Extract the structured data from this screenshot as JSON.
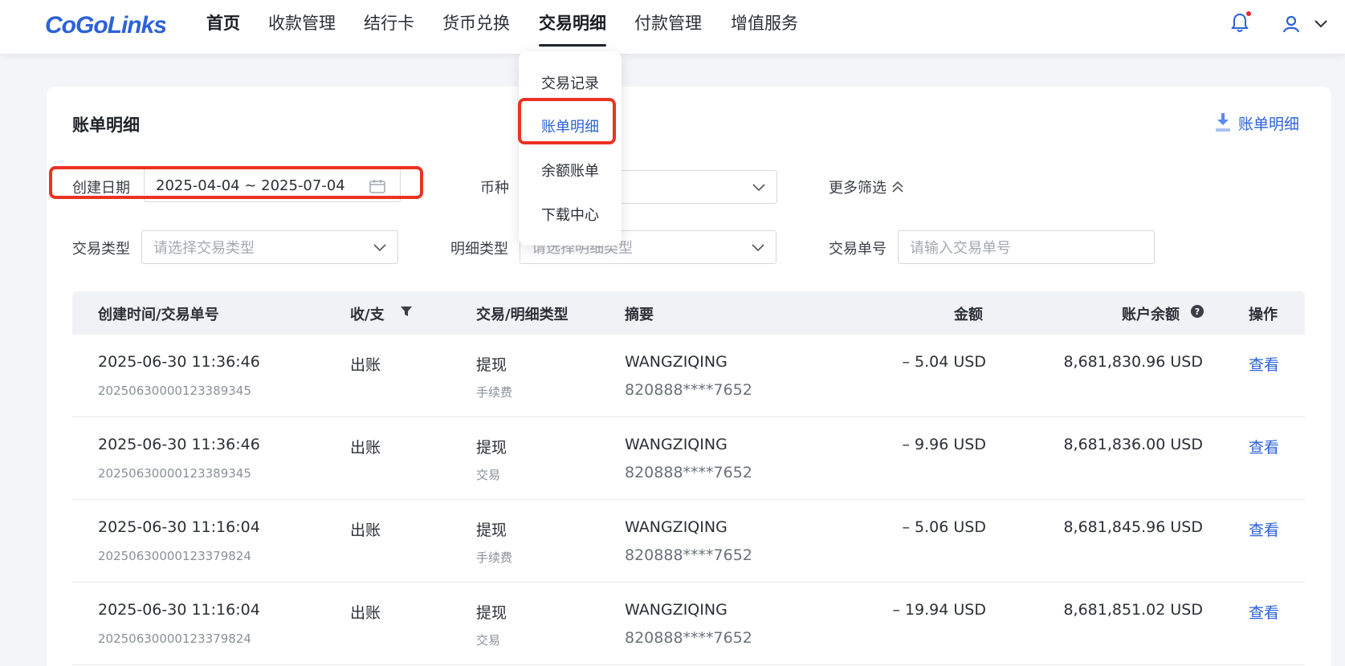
{
  "brand": {
    "name": "CoGoLinks",
    "color": "#2b62d6"
  },
  "nav": {
    "items": [
      "首页",
      "收款管理",
      "结行卡",
      "货币兑换",
      "交易明细",
      "付款管理",
      "增值服务"
    ],
    "active_index": 4
  },
  "dropdown": {
    "items": [
      "交易记录",
      "账单明细",
      "余额账单",
      "下载中心"
    ],
    "active_index": 1
  },
  "page": {
    "title": "账单明细",
    "export_label": "账单明细"
  },
  "filters": {
    "date_label": "创建日期",
    "date_value": "2025-04-04 ~ 2025-07-04",
    "currency_label": "币种",
    "more_filters": "更多筛选",
    "tx_type_label": "交易类型",
    "tx_type_placeholder": "请选择交易类型",
    "detail_type_label": "明细类型",
    "detail_type_placeholder": "请选择明细类型",
    "tx_no_label": "交易单号",
    "tx_no_placeholder": "请输入交易单号"
  },
  "table": {
    "headers": {
      "time": "创建时间/交易单号",
      "direction": "收/支",
      "type": "交易/明细类型",
      "summary": "摘要",
      "amount": "金额",
      "balance": "账户余额",
      "action": "操作"
    },
    "rows": [
      {
        "time": "2025-06-30 11:36:46",
        "order_no": "20250630000123389345",
        "direction": "出账",
        "type": "提现",
        "subtype": "手续费",
        "name": "WANGZIQING",
        "account": "820888****7652",
        "amount": "– 5.04 USD",
        "balance": "8,681,830.96 USD",
        "action": "查看"
      },
      {
        "time": "2025-06-30 11:36:46",
        "order_no": "20250630000123389345",
        "direction": "出账",
        "type": "提现",
        "subtype": "交易",
        "name": "WANGZIQING",
        "account": "820888****7652",
        "amount": "– 9.96 USD",
        "balance": "8,681,836.00 USD",
        "action": "查看"
      },
      {
        "time": "2025-06-30 11:16:04",
        "order_no": "20250630000123379824",
        "direction": "出账",
        "type": "提现",
        "subtype": "手续费",
        "name": "WANGZIQING",
        "account": "820888****7652",
        "amount": "– 5.06 USD",
        "balance": "8,681,845.96 USD",
        "action": "查看"
      },
      {
        "time": "2025-06-30 11:16:04",
        "order_no": "20250630000123379824",
        "direction": "出账",
        "type": "提现",
        "subtype": "交易",
        "name": "WANGZIQING",
        "account": "820888****7652",
        "amount": "– 19.94 USD",
        "balance": "8,681,851.02 USD",
        "action": "查看"
      }
    ]
  }
}
